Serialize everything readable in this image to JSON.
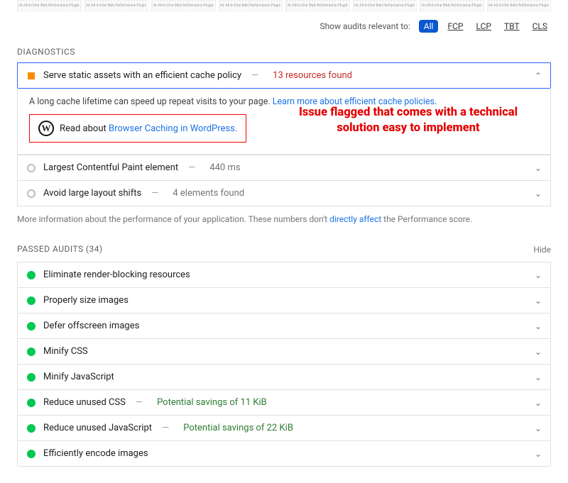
{
  "thumbs": {
    "label": "An All-In-One Web Performance Plugin"
  },
  "filter": {
    "label": "Show audits relevant to:",
    "items": [
      "All",
      "FCP",
      "LCP",
      "TBT",
      "CLS"
    ],
    "active": "All"
  },
  "diagnostics": {
    "label": "Diagnostics",
    "audits": [
      {
        "title": "Serve static assets with an efficient cache policy",
        "sub": "13 resources found",
        "subColor": "red",
        "indicator": "warn",
        "expanded": true
      },
      {
        "title": "Largest Contentful Paint element",
        "sub": "440 ms",
        "subColor": "gray",
        "indicator": "gray",
        "expanded": false
      },
      {
        "title": "Avoid large layout shifts",
        "sub": "4 elements found",
        "subColor": "gray",
        "indicator": "gray",
        "expanded": false
      }
    ],
    "expandedBody": {
      "text": "A long cache lifetime can speed up repeat visits to your page. ",
      "link": "Learn more about efficient cache policies",
      "readPrefix": "Read about ",
      "readLink": "Browser Caching in WordPress.",
      "annotation": "Issue flagged that comes with a technical solution easy to implement"
    },
    "footnote_pre": "More information about the performance of your application. These numbers don't ",
    "footnote_link": "directly affect",
    "footnote_post": " the Performance score."
  },
  "passed": {
    "label": "Passed Audits",
    "count": "(34)",
    "hide": "Hide",
    "audits": [
      {
        "title": "Eliminate render-blocking resources",
        "sub": "",
        "subColor": ""
      },
      {
        "title": "Properly size images",
        "sub": "",
        "subColor": ""
      },
      {
        "title": "Defer offscreen images",
        "sub": "",
        "subColor": ""
      },
      {
        "title": "Minify CSS",
        "sub": "",
        "subColor": ""
      },
      {
        "title": "Minify JavaScript",
        "sub": "",
        "subColor": ""
      },
      {
        "title": "Reduce unused CSS",
        "sub": "Potential savings of 11 KiB",
        "subColor": "green"
      },
      {
        "title": "Reduce unused JavaScript",
        "sub": "Potential savings of 22 KiB",
        "subColor": "green"
      },
      {
        "title": "Efficiently encode images",
        "sub": "",
        "subColor": ""
      }
    ]
  }
}
